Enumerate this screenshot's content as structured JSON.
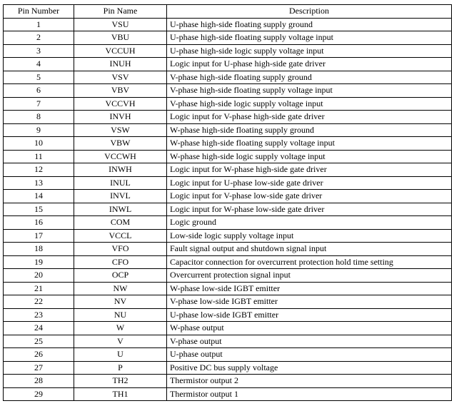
{
  "table": {
    "headers": [
      "Pin Number",
      "Pin Name",
      "Description"
    ],
    "rows": [
      [
        "1",
        "VSU",
        "U-phase high-side floating supply ground"
      ],
      [
        "2",
        "VBU",
        "U-phase high-side floating supply voltage input"
      ],
      [
        "3",
        "VCCUH",
        "U-phase high-side logic supply voltage input"
      ],
      [
        "4",
        "INUH",
        "Logic input for U-phase high-side gate driver"
      ],
      [
        "5",
        "VSV",
        "V-phase high-side floating supply ground"
      ],
      [
        "6",
        "VBV",
        "V-phase high-side floating supply voltage input"
      ],
      [
        "7",
        "VCCVH",
        "V-phase high-side logic supply voltage input"
      ],
      [
        "8",
        "INVH",
        "Logic input for V-phase high-side gate driver"
      ],
      [
        "9",
        "VSW",
        "W-phase high-side floating supply ground"
      ],
      [
        "10",
        "VBW",
        "W-phase high-side floating supply voltage input"
      ],
      [
        "11",
        "VCCWH",
        "W-phase high-side logic supply voltage input"
      ],
      [
        "12",
        "INWH",
        "Logic input for W-phase high-side gate driver"
      ],
      [
        "13",
        "INUL",
        "Logic input for U-phase low-side gate driver"
      ],
      [
        "14",
        "INVL",
        "Logic input for V-phase low-side gate driver"
      ],
      [
        "15",
        "INWL",
        "Logic input for W-phase low-side gate driver"
      ],
      [
        "16",
        "COM",
        "Logic ground"
      ],
      [
        "17",
        "VCCL",
        "Low-side logic supply voltage input"
      ],
      [
        "18",
        "VFO",
        "Fault signal output and shutdown signal input"
      ],
      [
        "19",
        "CFO",
        "Capacitor connection for overcurrent protection hold time setting"
      ],
      [
        "20",
        "OCP",
        "Overcurrent protection signal input"
      ],
      [
        "21",
        "NW",
        "W-phase low-side IGBT emitter"
      ],
      [
        "22",
        "NV",
        "V-phase low-side IGBT emitter"
      ],
      [
        "23",
        "NU",
        "U-phase low-side IGBT emitter"
      ],
      [
        "24",
        "W",
        "W-phase output"
      ],
      [
        "25",
        "V",
        "V-phase output"
      ],
      [
        "26",
        "U",
        "U-phase output"
      ],
      [
        "27",
        "P",
        "Positive DC bus supply voltage"
      ],
      [
        "28",
        "TH2",
        "Thermistor output 2"
      ],
      [
        "29",
        "TH1",
        "Thermistor output 1"
      ]
    ]
  }
}
